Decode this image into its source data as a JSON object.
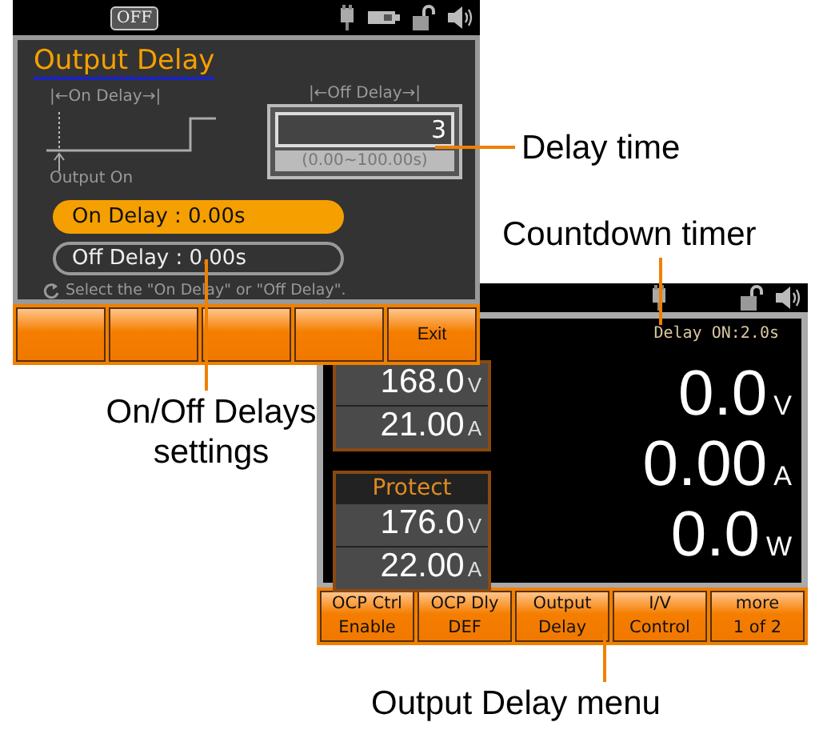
{
  "setup_screen": {
    "status_badge": "OFF",
    "title": "Output Delay",
    "diagram": {
      "on_delay_label": "|←On Delay→|",
      "output_on_label": "Output On"
    },
    "entry": {
      "label": "|←Off Delay→|",
      "value": "3",
      "range": "(0.00~100.00s)"
    },
    "options": [
      {
        "label": "On Delay : 0.00s",
        "selected": true
      },
      {
        "label": "Off Delay : 0.00s",
        "selected": false
      }
    ],
    "hint": "Select the \"On Delay\" or \"Off Delay\".",
    "softkeys": [
      {
        "label": "Exit"
      }
    ]
  },
  "main_screen": {
    "countdown": "Delay ON:2.0s",
    "settings": [
      {
        "value": "168.0",
        "unit": "V"
      },
      {
        "value": "21.00",
        "unit": "A"
      }
    ],
    "protect": {
      "title": "Protect",
      "values": [
        {
          "value": "176.0",
          "unit": "V"
        },
        {
          "value": "22.00",
          "unit": "A"
        }
      ]
    },
    "readouts": [
      {
        "value": "0.0",
        "unit": "V"
      },
      {
        "value": "0.00",
        "unit": "A"
      },
      {
        "value": "0.0",
        "unit": "W"
      }
    ],
    "softkeys": [
      {
        "line1": "OCP Ctrl",
        "line2": "Enable"
      },
      {
        "line1": "OCP Dly",
        "line2": "DEF"
      },
      {
        "line1": "Output",
        "line2": "Delay"
      },
      {
        "line1": "I/V",
        "line2": "Control"
      },
      {
        "line1": "more",
        "line2": "1 of 2"
      }
    ]
  },
  "callouts": [
    {
      "kind": "delay_time",
      "text": "Delay time"
    },
    {
      "kind": "countdown",
      "text": "Countdown timer"
    },
    {
      "kind": "settings",
      "text": "On/Off Delays settings"
    },
    {
      "kind": "menu",
      "text": "Output Delay menu"
    }
  ]
}
